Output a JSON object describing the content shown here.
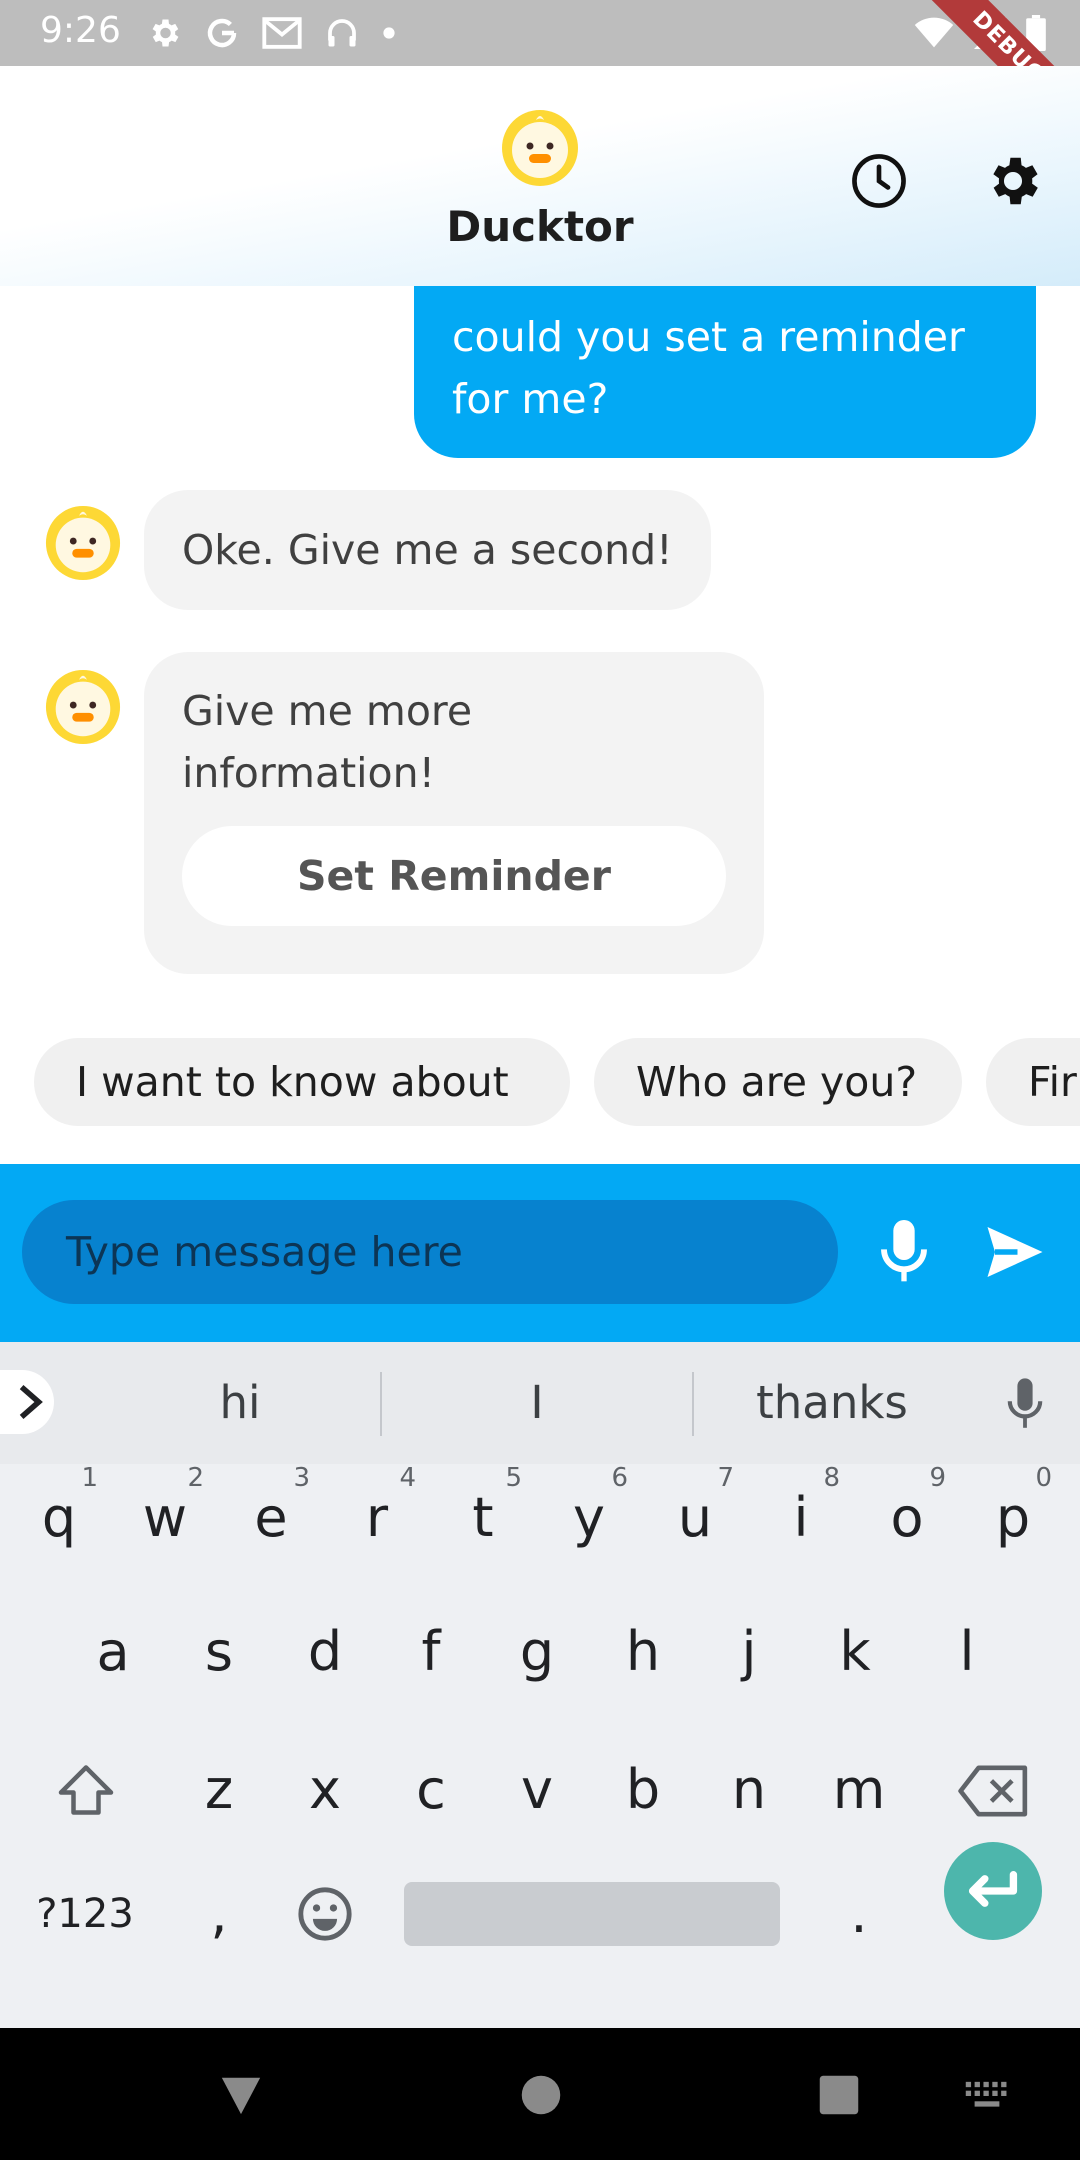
{
  "status_bar": {
    "time": "9:26",
    "debug_label": "DEBUG",
    "left_icons": [
      "settings-icon",
      "google-icon",
      "gmail-icon",
      "headphones-icon",
      "dot-icon"
    ],
    "right_icons": [
      "wifi-icon",
      "signal-icon",
      "battery-icon"
    ]
  },
  "header": {
    "title": "Ducktor",
    "logo": "duck-logo-icon",
    "actions": [
      "history-icon",
      "gear-icon"
    ]
  },
  "chat": {
    "messages": [
      {
        "sender": "user",
        "text": "could you set a reminder for me?"
      },
      {
        "sender": "bot",
        "text": "Oke. Give me a second!"
      },
      {
        "sender": "bot",
        "text": "Give me more information!",
        "button": "Set Reminder"
      }
    ]
  },
  "quick_replies": [
    "I want to know about",
    "Who are you?",
    "Fir"
  ],
  "input": {
    "placeholder": "Type message here",
    "mic_icon": "microphone-icon",
    "send_icon": "send-icon"
  },
  "keyboard": {
    "suggestions": [
      "hi",
      "I",
      "thanks"
    ],
    "row1": [
      "q",
      "w",
      "e",
      "r",
      "t",
      "y",
      "u",
      "i",
      "o",
      "p"
    ],
    "row1_hints": [
      "1",
      "2",
      "3",
      "4",
      "5",
      "6",
      "7",
      "8",
      "9",
      "0"
    ],
    "row2": [
      "a",
      "s",
      "d",
      "f",
      "g",
      "h",
      "j",
      "k",
      "l"
    ],
    "row3": [
      "z",
      "x",
      "c",
      "v",
      "b",
      "n",
      "m"
    ],
    "symbols_label": "?123",
    "comma": ",",
    "period": "."
  },
  "colors": {
    "accent": "#03a9f4",
    "input_field": "#0782cf",
    "bot_bubble": "#f3f3f3",
    "enter_key": "#4db6ac",
    "duck_yellow": "#fdd835"
  }
}
